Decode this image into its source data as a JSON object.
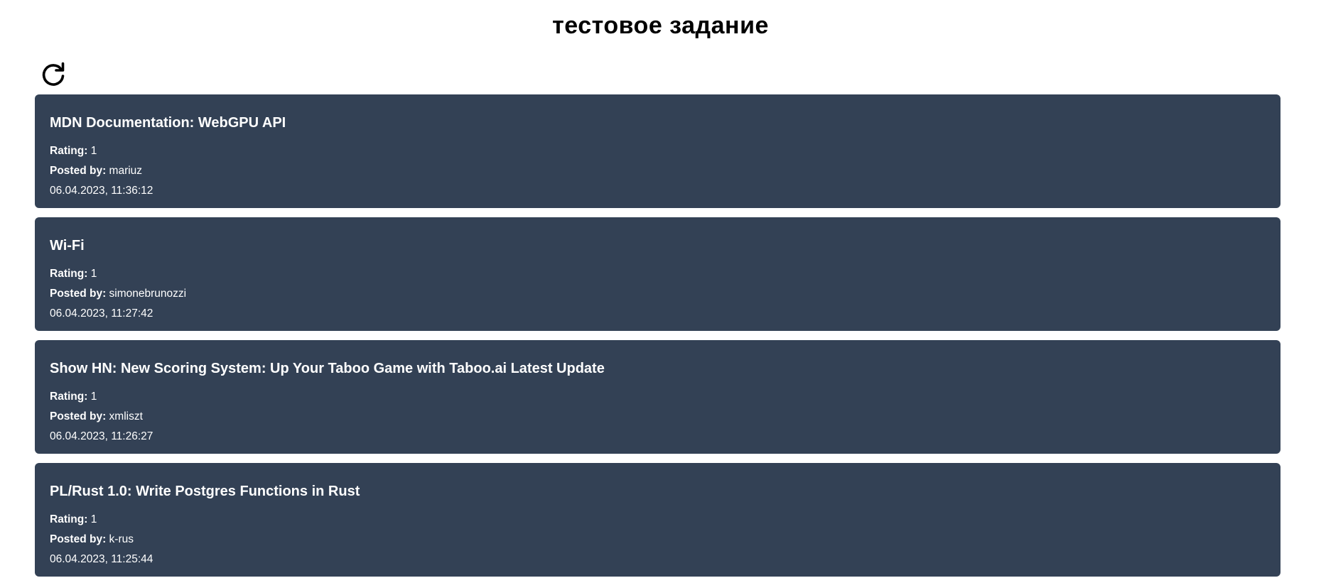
{
  "page": {
    "title": "тестовое задание"
  },
  "colors": {
    "card_background": "#334155",
    "card_text": "#ffffff",
    "title_text": "#000000"
  },
  "toolbar": {
    "refresh_icon": "refresh-icon"
  },
  "stories": [
    {
      "title": "MDN Documentation: WebGPU API",
      "rating_label": "Rating:",
      "rating": "1",
      "author_label": "Posted by:",
      "author": "mariuz",
      "date": "06.04.2023, 11:36:12"
    },
    {
      "title": "Wi-Fi",
      "rating_label": "Rating:",
      "rating": "1",
      "author_label": "Posted by:",
      "author": "simonebrunozzi",
      "date": "06.04.2023, 11:27:42"
    },
    {
      "title": "Show HN: New Scoring System: Up Your Taboo Game with Taboo.ai Latest Update",
      "rating_label": "Rating:",
      "rating": "1",
      "author_label": "Posted by:",
      "author": "xmliszt",
      "date": "06.04.2023, 11:26:27"
    },
    {
      "title": "PL/Rust 1.0: Write Postgres Functions in Rust",
      "rating_label": "Rating:",
      "rating": "1",
      "author_label": "Posted by:",
      "author": "k-rus",
      "date": "06.04.2023, 11:25:44"
    }
  ]
}
